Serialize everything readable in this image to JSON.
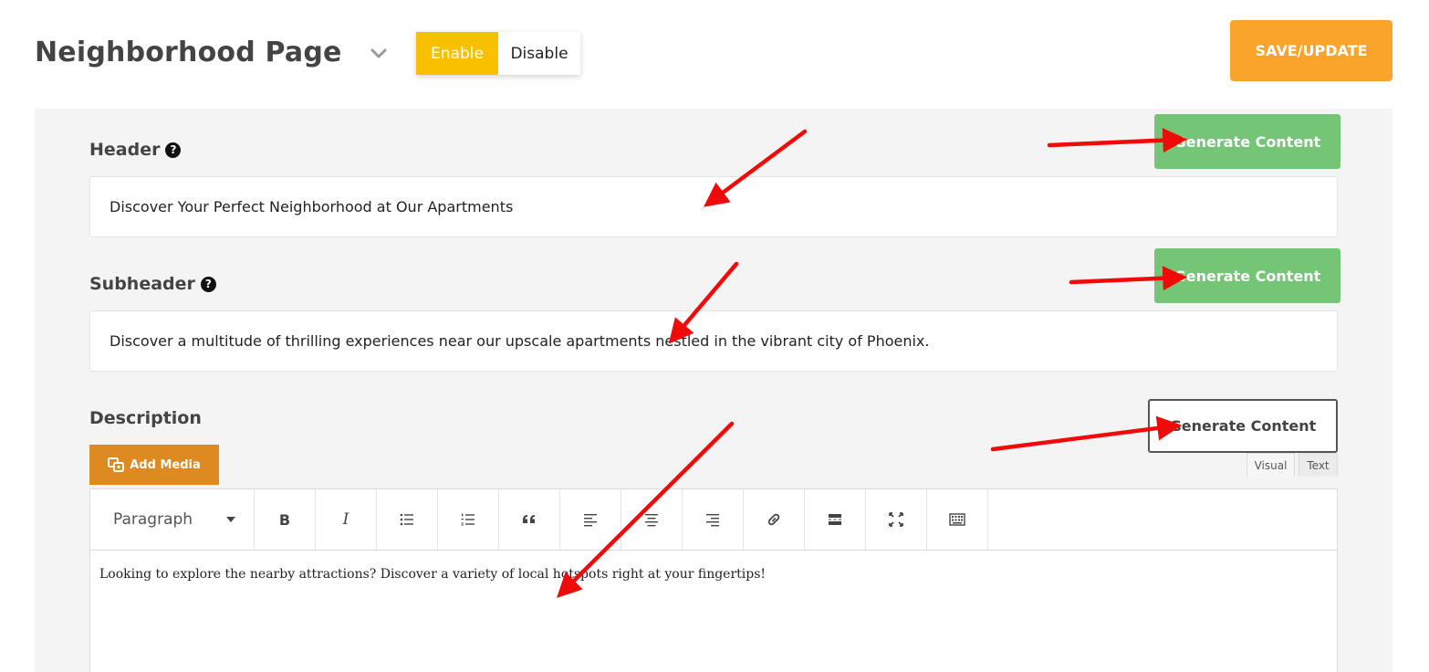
{
  "page": {
    "title": "Neighborhood Page"
  },
  "toggle": {
    "enable_label": "Enable",
    "disable_label": "Disable"
  },
  "actions": {
    "save_label": "SAVE/UPDATE"
  },
  "fields": {
    "header": {
      "label": "Header",
      "value": "Discover Your Perfect Neighborhood at Our Apartments",
      "generate_label": "Generate Content"
    },
    "subheader": {
      "label": "Subheader",
      "value": "Discover a multitude of thrilling experiences near our upscale apartments nestled in the vibrant city of Phoenix.",
      "generate_label": "Generate Content"
    },
    "description": {
      "label": "Description",
      "generate_label": "Generate Content",
      "add_media_label": "Add Media",
      "tabs": [
        "Visual",
        "Text"
      ],
      "format": "Paragraph",
      "content": "Looking to explore the nearby attractions? Discover a variety of local hotspots right at your fingertips!"
    }
  },
  "toolbar": {
    "bold": "B",
    "italic": "I",
    "icons": [
      "bullet-list-icon",
      "numbered-list-icon",
      "blockquote-icon",
      "align-left-icon",
      "align-center-icon",
      "align-right-icon",
      "link-icon",
      "read-more-icon",
      "fullscreen-icon",
      "toolbar-toggle-icon"
    ]
  },
  "colors": {
    "accent_yellow": "#f9c000",
    "save_orange": "#fba42b",
    "generate_green": "#74c576",
    "add_media_orange": "#dd8a20",
    "annotation_red": "#f10a0a"
  }
}
